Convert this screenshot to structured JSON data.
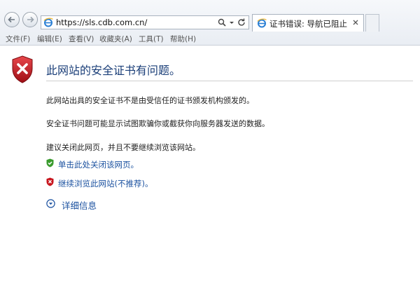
{
  "browser": {
    "address_url": "https://sls.cdb.com.cn/",
    "tab_title": "证书错误: 导航已阻止",
    "menus": [
      "文件(F)",
      "编辑(E)",
      "查看(V)",
      "收藏夹(A)",
      "工具(T)",
      "帮助(H)"
    ],
    "icons": {
      "back": "back-arrow-icon",
      "forward": "forward-arrow-icon",
      "site": "ie-logo-icon",
      "search": "search-icon",
      "dropdown": "dropdown-icon",
      "refresh": "refresh-icon",
      "close_tab": "close-icon"
    }
  },
  "page": {
    "title": "此网站的安全证书有问题。",
    "paragraphs": [
      "此网站出具的安全证书不是由受信任的证书颁发机构颁发的。",
      "安全证书问题可能显示试图欺骗你或截获你向服务器发送的数据。",
      "建议关闭此网页，并且不要继续浏览该网站。"
    ],
    "options": [
      {
        "label": "单击此处关闭该网页。",
        "icon": "green-shield-check-icon"
      },
      {
        "label": "继续浏览此网站(不推荐)。",
        "icon": "red-shield-x-icon"
      }
    ],
    "more_info": "详细信息"
  },
  "colors": {
    "title": "#1a3e78",
    "link": "#1c52a0",
    "warning_red": "#c8161e",
    "safe_green": "#3a9b2e"
  }
}
